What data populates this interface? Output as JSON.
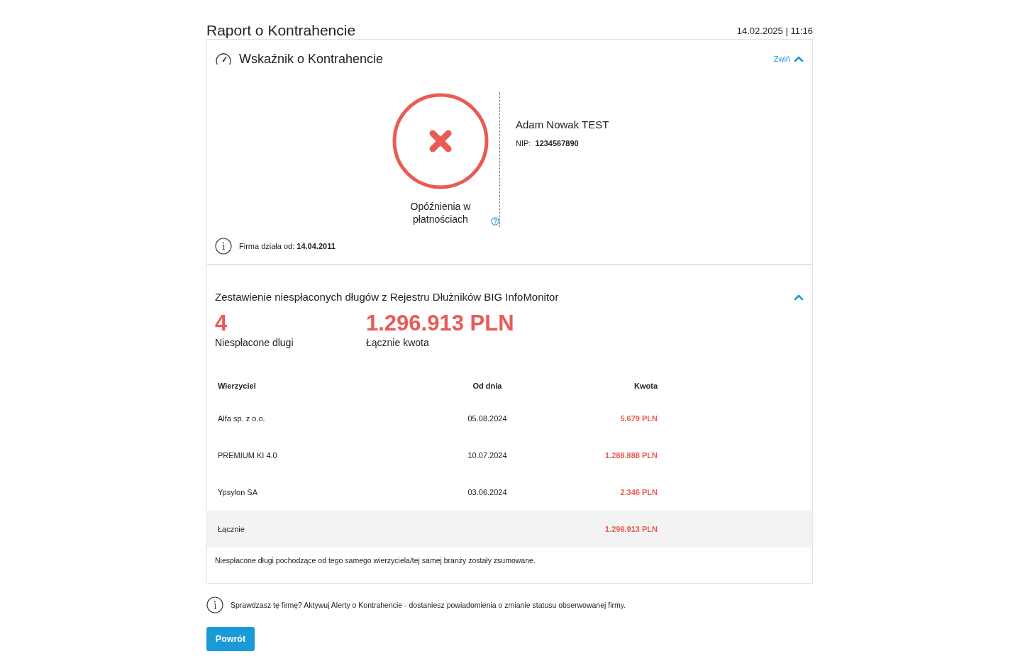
{
  "header": {
    "title": "Raport o Kontrahencie",
    "timestamp": "14.02.2025 | 11:16"
  },
  "indicator": {
    "title": "Wskaźnik o Kontrahencie",
    "collapse_label": "Zwiń",
    "expanded": true,
    "kind": "negative",
    "status_label": "Opóźnienia w płatnościach",
    "company_name": "Adam Nowak TEST",
    "nip_label": "NIP:",
    "nip": "1234567890",
    "founded_label": "Firma działa od:",
    "founded": "14.04.2011"
  },
  "debts": {
    "title": "Zestawienie niespłaconych długów z Rejestru Dłużników BIG InfoMonitor",
    "expanded": true,
    "stats": [
      {
        "value": "4",
        "label": "Niespłacone dlugi"
      },
      {
        "value": "1.296.913 PLN",
        "label": "Łącznie kwota"
      }
    ],
    "table": {
      "columns": [
        "Wierzyciel",
        "Od dnia",
        "Kwota"
      ],
      "rows": [
        {
          "creditor": "Alfa sp. z o.o.",
          "date": "05.08.2024",
          "amount": "5.679 PLN"
        },
        {
          "creditor": "PREMIUM KI 4.0",
          "date": "10.07.2024",
          "amount": "1.288.888 PLN"
        },
        {
          "creditor": "Ypsylon SA",
          "date": "03.06.2024",
          "amount": "2.346 PLN"
        }
      ],
      "total": {
        "label": "Łącznie",
        "amount": "1.296.913 PLN"
      }
    },
    "note": "Niespłacone długi pochodzące od tego samego wierzyciela/tej samej branży zostały zsumowane."
  },
  "alert": "Sprawdzasz tę firmę? Aktywuj Alerty o Kontrahencie - dostaniesz powiadomienia o zmianie statusu obserwowanej firmy.",
  "back_button": "Powrót"
}
